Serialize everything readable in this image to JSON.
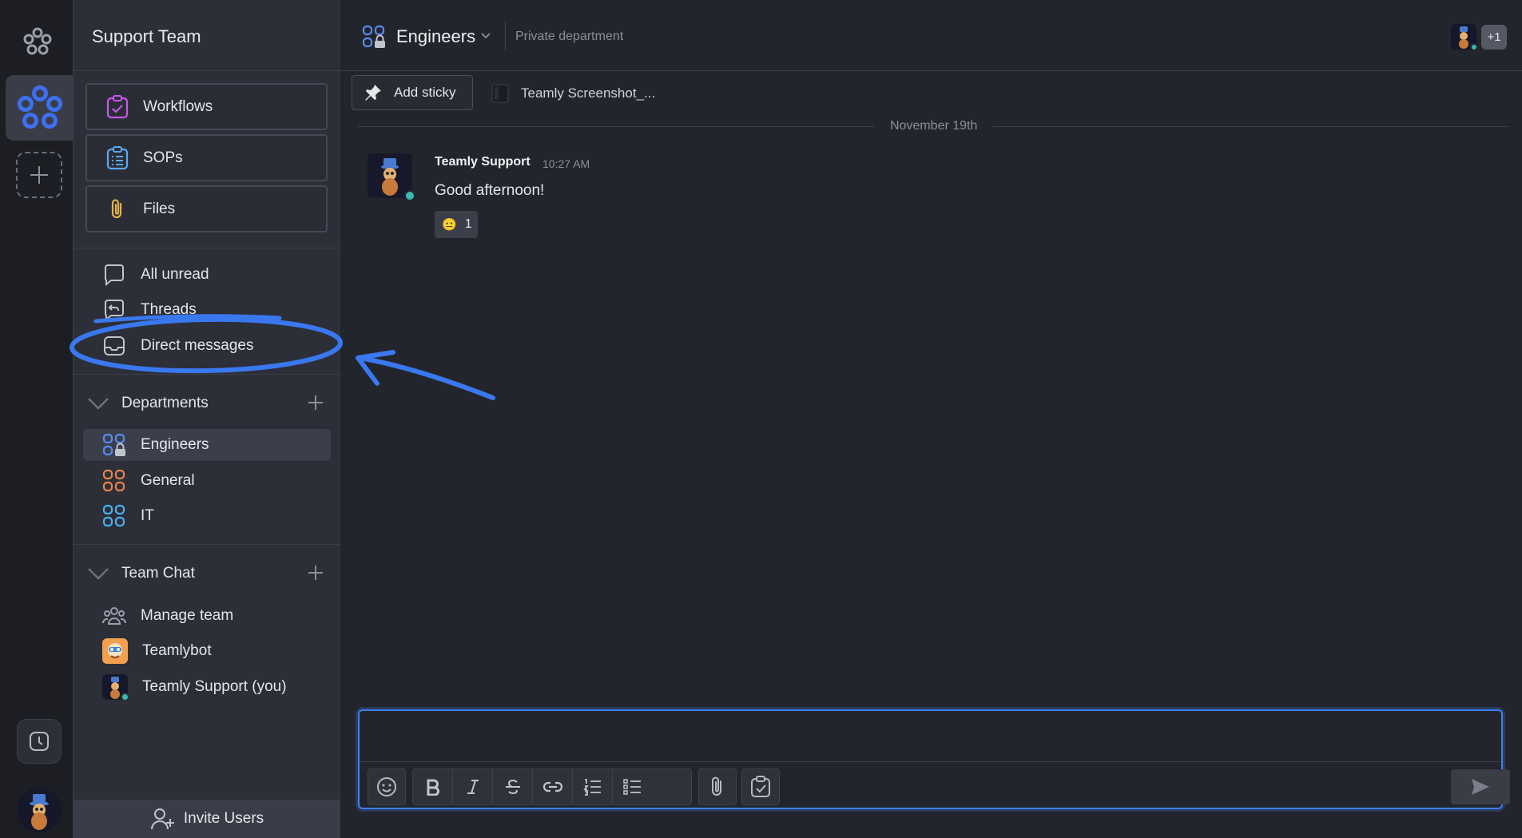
{
  "workspace": {
    "name": "Support Team"
  },
  "features": [
    {
      "label": "Workflows",
      "icon": "workflows-icon",
      "color": "#c658e8"
    },
    {
      "label": "SOPs",
      "icon": "sops-icon",
      "color": "#5aa8f0"
    },
    {
      "label": "Files",
      "icon": "paperclip-icon",
      "color": "#e8b04a"
    }
  ],
  "nav": [
    {
      "label": "All unread",
      "icon": "chat-bubble-icon"
    },
    {
      "label": "Threads",
      "icon": "threads-icon"
    },
    {
      "label": "Direct messages",
      "icon": "inbox-icon"
    }
  ],
  "departments": {
    "label": "Departments",
    "items": [
      {
        "label": "Engineers",
        "color": "#5a8af0",
        "locked": true,
        "active": true
      },
      {
        "label": "General",
        "color": "#e8844a",
        "locked": false,
        "active": false
      },
      {
        "label": "IT",
        "color": "#4ab0f0",
        "locked": false,
        "active": false
      }
    ]
  },
  "team_chat": {
    "label": "Team Chat",
    "items": [
      {
        "label": "Manage team",
        "icon": "people-icon"
      },
      {
        "label": "Teamlybot",
        "icon": "teamlybot-avatar"
      },
      {
        "label": "Teamly Support (you)",
        "icon": "user-avatar",
        "online": true
      }
    ]
  },
  "invite": {
    "label": "Invite Users"
  },
  "channel": {
    "name": "Engineers",
    "description": "Private department",
    "extra_members": "+1"
  },
  "stickies": {
    "add_label": "Add sticky",
    "file_label": "Teamly Screenshot_..."
  },
  "messages": {
    "date_divider": "November 19th",
    "items": [
      {
        "author": "Teamly Support",
        "time": "10:27 AM",
        "text": "Good afternoon!",
        "reaction_emoji": "😐",
        "reaction_count": "1"
      }
    ]
  },
  "composer": {
    "placeholder": "",
    "toolbar": [
      "emoji-icon",
      "bold-icon",
      "italic-icon",
      "strikethrough-icon",
      "link-icon",
      "numbered-list-icon",
      "bullet-list-icon",
      "attach-icon",
      "task-icon",
      "send-icon"
    ]
  },
  "colors": {
    "accent": "#3e7fef",
    "online": "#3bb8b0",
    "annotation": "#3a78f0"
  }
}
